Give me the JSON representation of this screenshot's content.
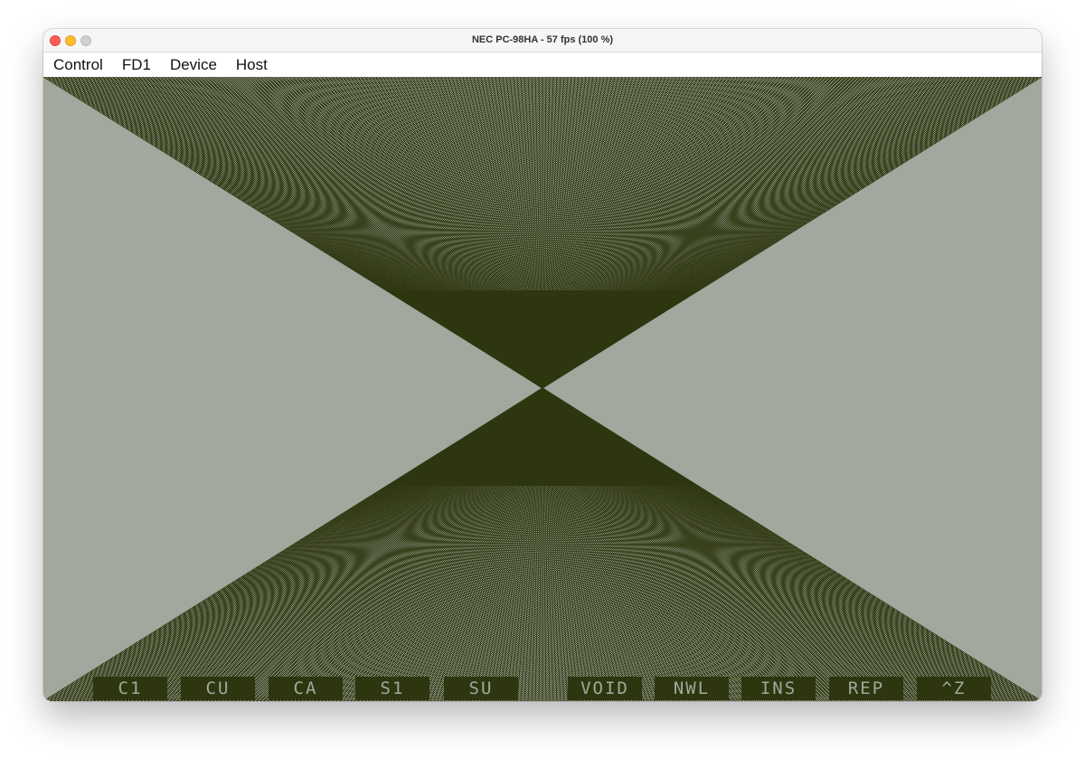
{
  "window": {
    "title": "NEC PC-98HA - 57 fps (100 %)"
  },
  "menu": [
    "Control",
    "FD1",
    "Device",
    "Host"
  ],
  "screen": {
    "foreground_color": "#2e3610",
    "background_color": "#a1a89d"
  },
  "function_keys": [
    "C1",
    "CU",
    "CA",
    "S1",
    "SU",
    "VOID",
    "NWL",
    "INS",
    "REP",
    "^Z"
  ]
}
